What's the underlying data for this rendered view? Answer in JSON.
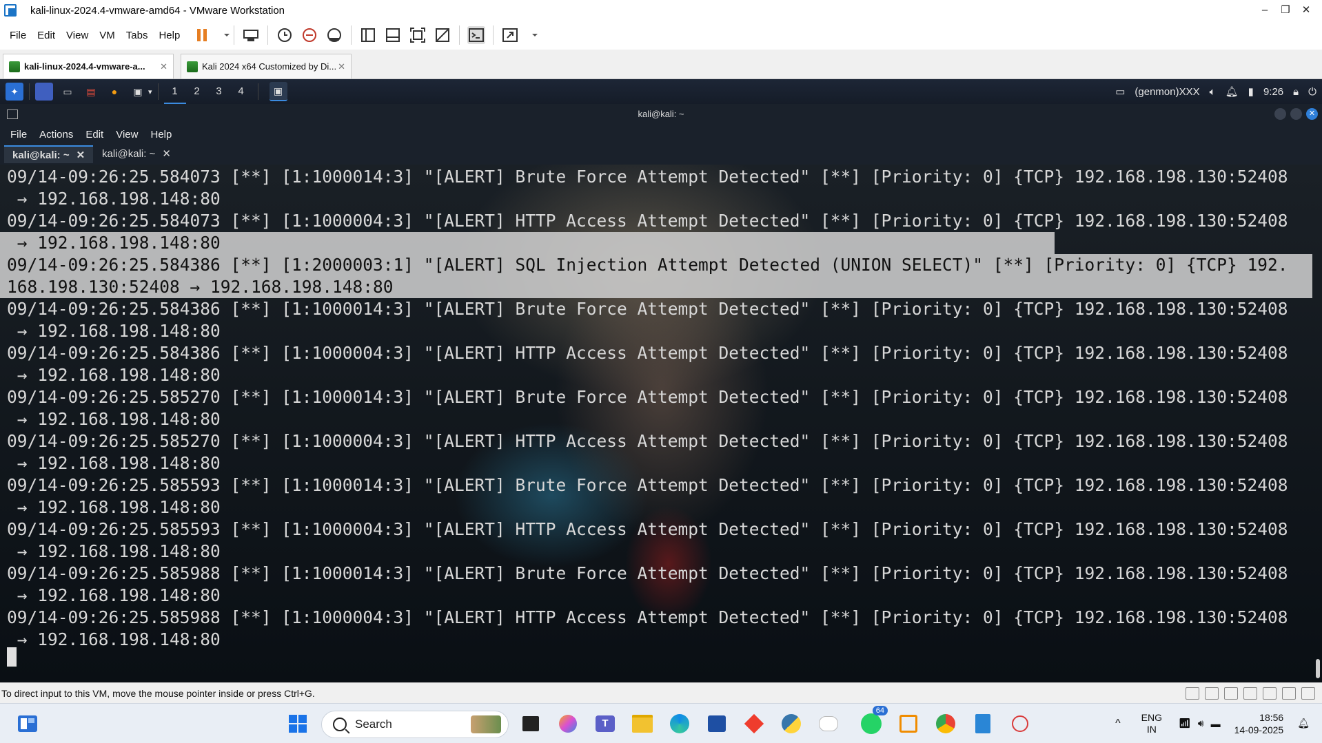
{
  "vmware": {
    "title": "kali-linux-2024.4-vmware-amd64 - VMware Workstation",
    "window_controls": [
      "–",
      "❐",
      "✕"
    ],
    "menu": [
      "File",
      "Edit",
      "View",
      "VM",
      "Tabs",
      "Help"
    ],
    "tabs": [
      {
        "label": "kali-linux-2024.4-vmware-a...",
        "close": "✕",
        "active": true
      },
      {
        "label": "Kali 2024 x64 Customized by Di...",
        "close": "✕",
        "active": false
      }
    ],
    "status_message": "To direct input to this VM, move the mouse pointer inside or press Ctrl+G."
  },
  "kali_panel": {
    "workspaces": [
      "1",
      "2",
      "3",
      "4"
    ],
    "genmon": "(genmon)XXX",
    "time": "9:26"
  },
  "terminal": {
    "window_title": "kali@kali: ~",
    "menu": [
      "File",
      "Actions",
      "Edit",
      "View",
      "Help"
    ],
    "tabs": [
      {
        "label": "kali@kali: ~",
        "close": "✕",
        "active": true
      },
      {
        "label": "kali@kali: ~",
        "close": "✕",
        "active": false
      }
    ],
    "lines": [
      {
        "text": "09/14-09:26:25.584073 [**] [1:1000014:3] \"[ALERT] Brute Force Attempt Detected\" [**] [Priority: 0] {TCP} 192.168.198.130:52408",
        "selected": false
      },
      {
        "text": " → 192.168.198.148:80",
        "selected": false
      },
      {
        "text": "09/14-09:26:25.584073 [**] [1:1000004:3] \"[ALERT] HTTP Access Attempt Detected\" [**] [Priority: 0] {TCP} 192.168.198.130:52408",
        "selected": false
      },
      {
        "text": " → 192.168.198.148:80",
        "selected": true
      },
      {
        "text": "09/14-09:26:25.584386 [**] [1:2000003:1] \"[ALERT] SQL Injection Attempt Detected (UNION SELECT)\" [**] [Priority: 0] {TCP} 192.",
        "selected": true
      },
      {
        "text": "168.198.130:52408 → 192.168.198.148:80",
        "selected": true
      },
      {
        "text": "09/14-09:26:25.584386 [**] [1:1000014:3] \"[ALERT] Brute Force Attempt Detected\" [**] [Priority: 0] {TCP} 192.168.198.130:52408",
        "selected": false
      },
      {
        "text": " → 192.168.198.148:80",
        "selected": false
      },
      {
        "text": "09/14-09:26:25.584386 [**] [1:1000004:3] \"[ALERT] HTTP Access Attempt Detected\" [**] [Priority: 0] {TCP} 192.168.198.130:52408",
        "selected": false
      },
      {
        "text": " → 192.168.198.148:80",
        "selected": false
      },
      {
        "text": "09/14-09:26:25.585270 [**] [1:1000014:3] \"[ALERT] Brute Force Attempt Detected\" [**] [Priority: 0] {TCP} 192.168.198.130:52408",
        "selected": false
      },
      {
        "text": " → 192.168.198.148:80",
        "selected": false
      },
      {
        "text": "09/14-09:26:25.585270 [**] [1:1000004:3] \"[ALERT] HTTP Access Attempt Detected\" [**] [Priority: 0] {TCP} 192.168.198.130:52408",
        "selected": false
      },
      {
        "text": " → 192.168.198.148:80",
        "selected": false
      },
      {
        "text": "09/14-09:26:25.585593 [**] [1:1000014:3] \"[ALERT] Brute Force Attempt Detected\" [**] [Priority: 0] {TCP} 192.168.198.130:52408",
        "selected": false
      },
      {
        "text": " → 192.168.198.148:80",
        "selected": false
      },
      {
        "text": "09/14-09:26:25.585593 [**] [1:1000004:3] \"[ALERT] HTTP Access Attempt Detected\" [**] [Priority: 0] {TCP} 192.168.198.130:52408",
        "selected": false
      },
      {
        "text": " → 192.168.198.148:80",
        "selected": false
      },
      {
        "text": "09/14-09:26:25.585988 [**] [1:1000014:3] \"[ALERT] Brute Force Attempt Detected\" [**] [Priority: 0] {TCP} 192.168.198.130:52408",
        "selected": false
      },
      {
        "text": " → 192.168.198.148:80",
        "selected": false
      },
      {
        "text": "09/14-09:26:25.585988 [**] [1:1000004:3] \"[ALERT] HTTP Access Attempt Detected\" [**] [Priority: 0] {TCP} 192.168.198.130:52408",
        "selected": false
      },
      {
        "text": " → 192.168.198.148:80",
        "selected": false
      }
    ]
  },
  "taskbar": {
    "search_placeholder": "Search",
    "whatsapp_badge": "64",
    "lang_top": "ENG",
    "lang_bottom": "IN",
    "time": "18:56",
    "date": "14-09-2025",
    "tray_chevron": "^"
  }
}
